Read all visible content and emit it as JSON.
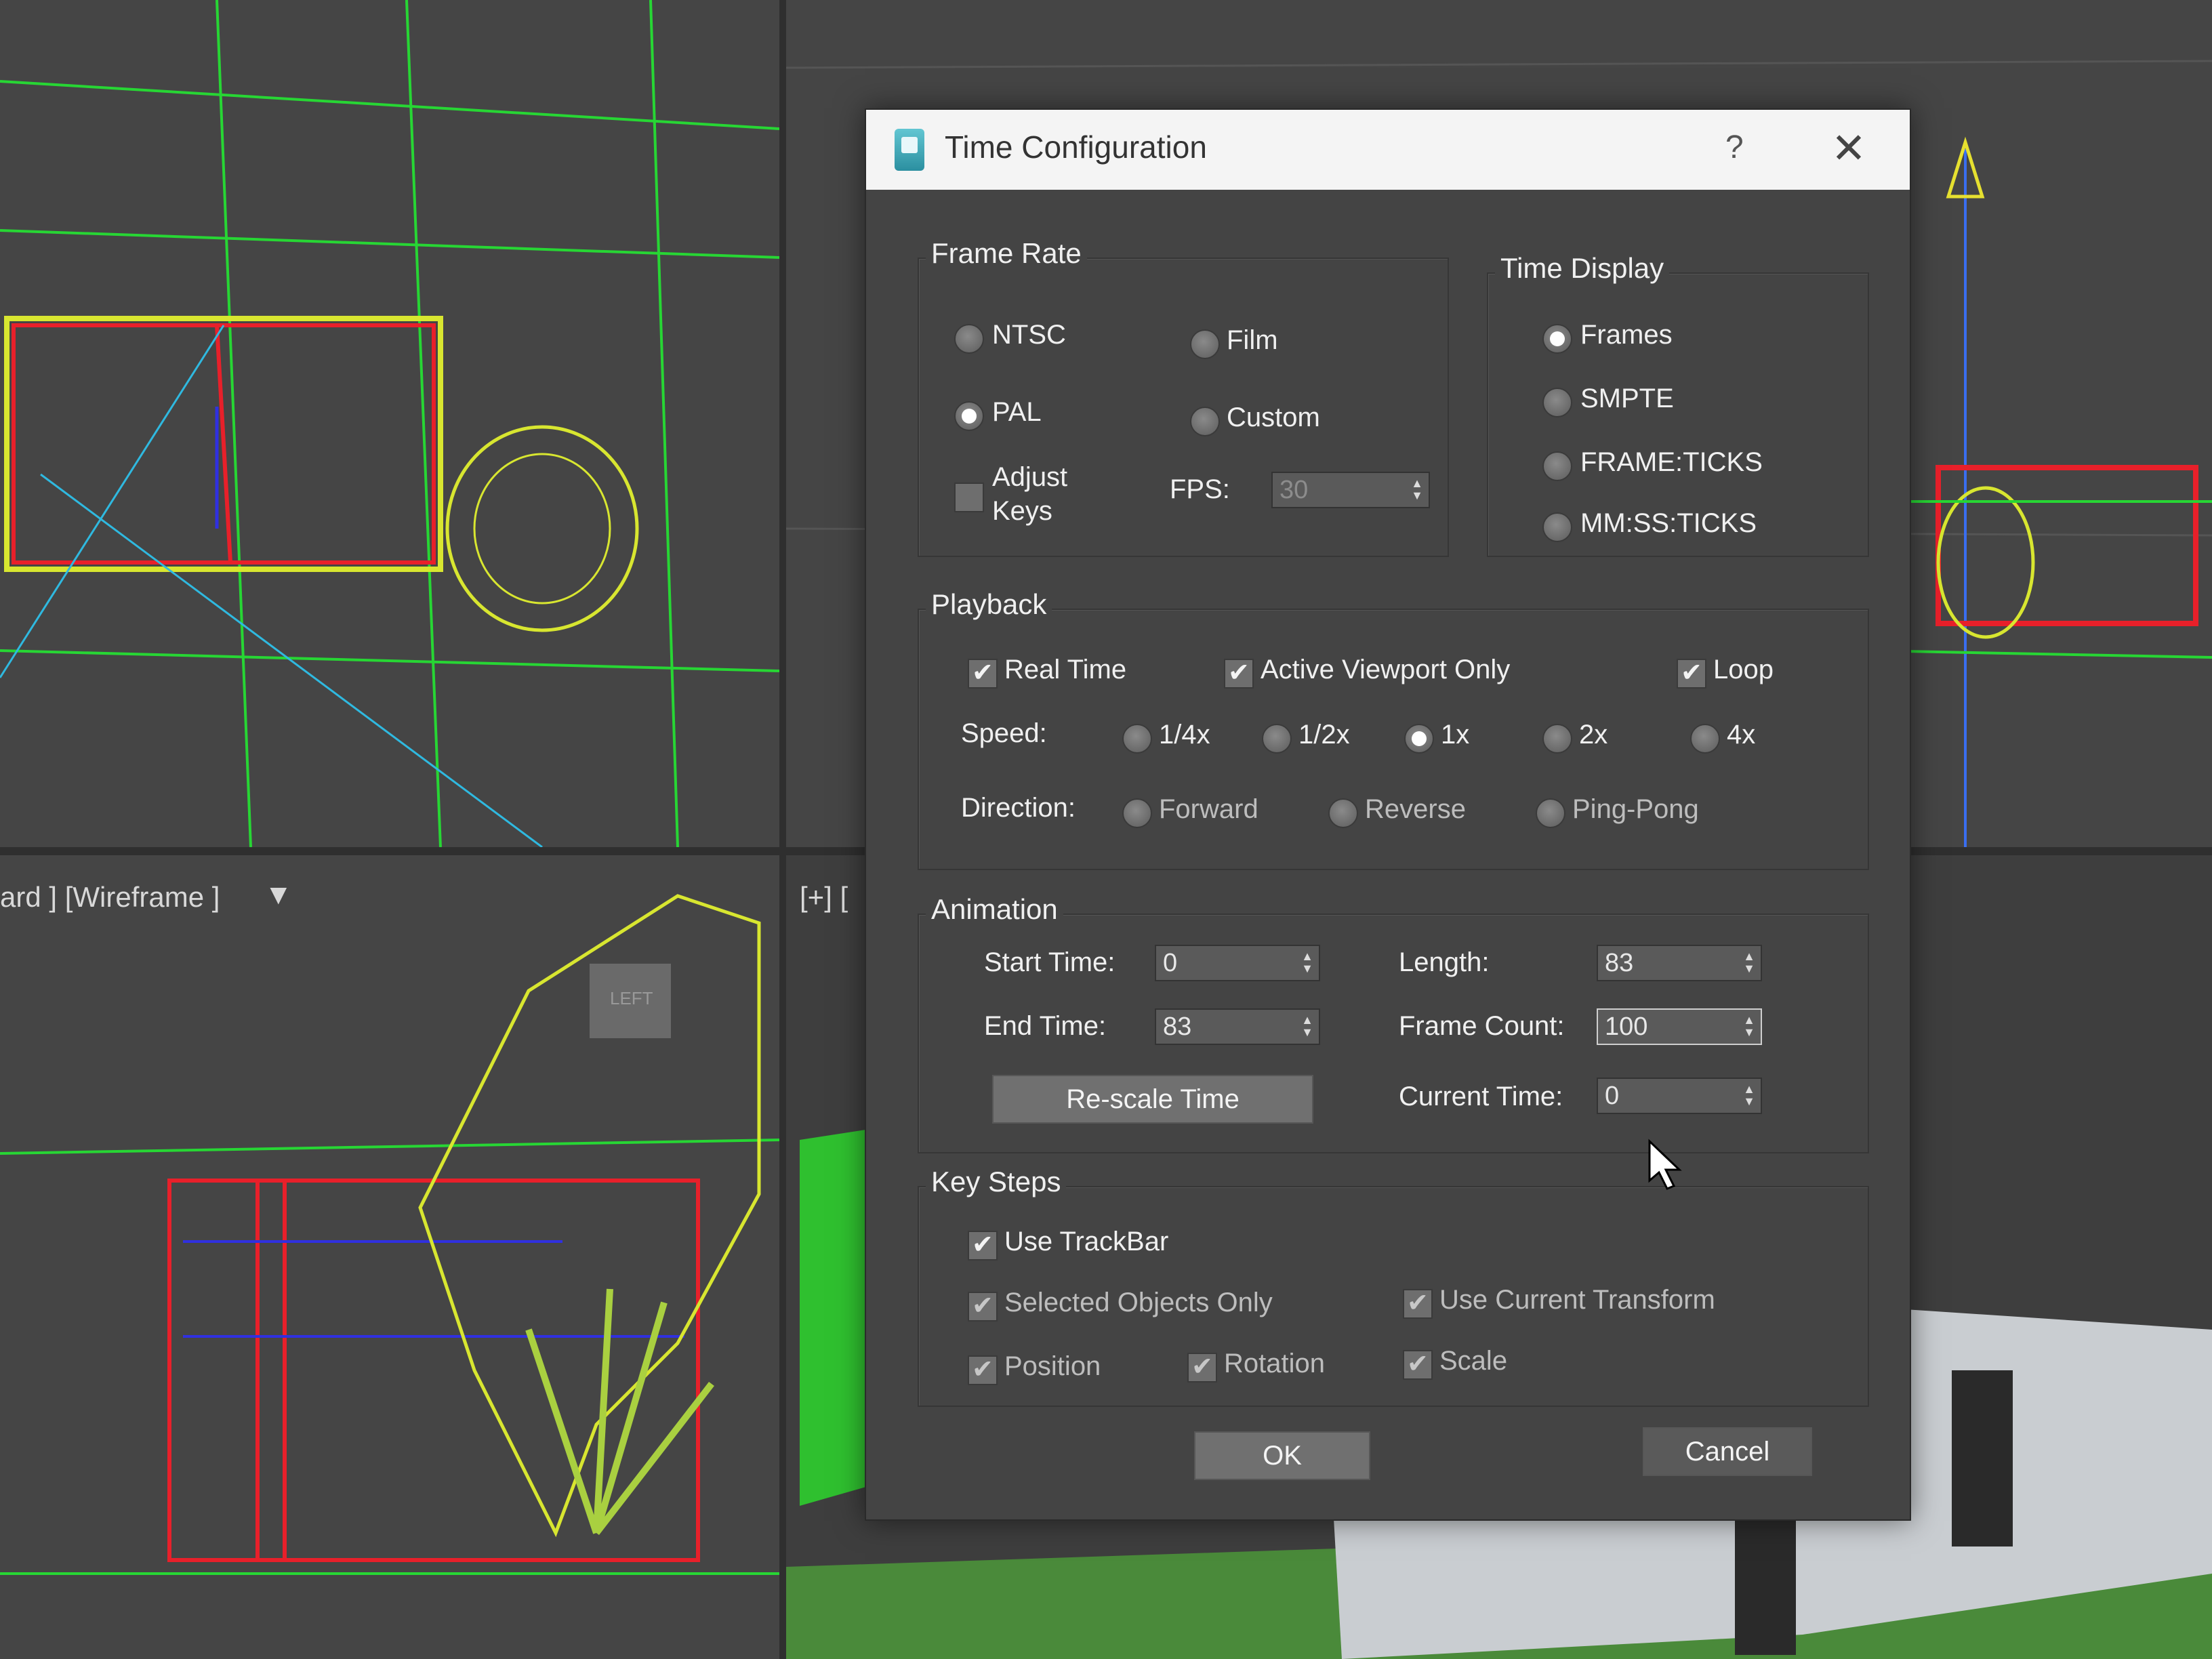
{
  "viewport": {
    "label": "ard ] [Wireframe ]",
    "label_plus": "[+] [",
    "nav_cube_label": "LEFT"
  },
  "dialog": {
    "title": "Time Configuration",
    "help": "?",
    "close": "✕",
    "frame_rate": {
      "title": "Frame Rate",
      "ntsc": "NTSC",
      "film": "Film",
      "pal": "PAL",
      "custom": "Custom",
      "adjust_keys_1": "Adjust",
      "adjust_keys_2": "Keys",
      "fps_label": "FPS:",
      "fps_value": "30",
      "selected": "PAL"
    },
    "time_display": {
      "title": "Time Display",
      "frames": "Frames",
      "smpte": "SMPTE",
      "frame_ticks": "FRAME:TICKS",
      "mm_ss_ticks": "MM:SS:TICKS",
      "selected": "Frames"
    },
    "playback": {
      "title": "Playback",
      "real_time": "Real Time",
      "active_viewport_only": "Active Viewport Only",
      "loop": "Loop",
      "speed_label": "Speed:",
      "speed_quarter": "1/4x",
      "speed_half": "1/2x",
      "speed_1x": "1x",
      "speed_2x": "2x",
      "speed_4x": "4x",
      "speed_selected": "1x",
      "direction_label": "Direction:",
      "forward": "Forward",
      "reverse": "Reverse",
      "ping_pong": "Ping-Pong"
    },
    "animation": {
      "title": "Animation",
      "start_time_label": "Start Time:",
      "start_time": "0",
      "end_time_label": "End Time:",
      "end_time": "83",
      "length_label": "Length:",
      "length": "83",
      "frame_count_label": "Frame Count:",
      "frame_count": "100",
      "current_time_label": "Current Time:",
      "current_time": "0",
      "rescale": "Re-scale Time"
    },
    "key_steps": {
      "title": "Key Steps",
      "use_trackbar": "Use TrackBar",
      "selected_objects_only": "Selected Objects Only",
      "use_current_transform": "Use Current Transform",
      "position": "Position",
      "rotation": "Rotation",
      "scale": "Scale"
    },
    "ok": "OK",
    "cancel": "Cancel"
  },
  "colors": {
    "accent_wire_green": "#27d634",
    "wire_yellow": "#d8e630",
    "wire_red": "#e8202a",
    "wire_blue": "#3030e0",
    "dialog_bg": "#444444"
  }
}
